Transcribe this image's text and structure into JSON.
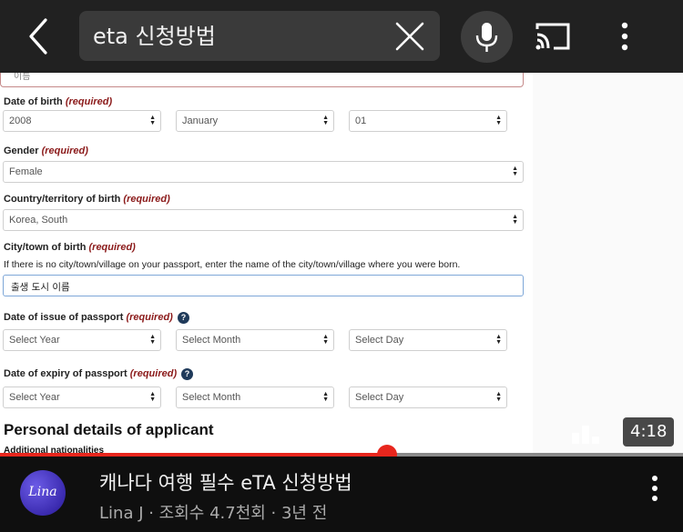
{
  "search": {
    "query": "eta 신청방법"
  },
  "video": {
    "duration": "4:18",
    "progress_fraction": 0.567,
    "form": {
      "field_remnant": "이름",
      "dob_label": "Date of birth",
      "required_text": "(required)",
      "dob_year": "2008",
      "dob_month": "January",
      "dob_day": "01",
      "gender_label": "Gender",
      "gender_value": "Female",
      "country_label": "Country/territory of birth",
      "country_value": "Korea, South",
      "city_label": "City/town of birth",
      "city_hint": "If there is no city/town/village on your passport, enter the name of the city/town/village where you were born.",
      "city_value": "출생 도시 이름",
      "issue_label": "Date of issue of passport",
      "expiry_label": "Date of expiry of passport",
      "select_year": "Select Year",
      "select_month": "Select Month",
      "select_day": "Select Day",
      "help_glyph": "?",
      "section_title": "Personal details of applicant",
      "section_sub": "Additional nationalities"
    }
  },
  "details": {
    "title": "캐나다 여행 필수 eTA 신청방법",
    "meta": "Lina J · 조회수 4.7천회 · 3년 전",
    "avatar_text": "Lina"
  },
  "colors": {
    "progress": "#e8261d",
    "required": "#8b1a1a",
    "background": "#0f0f0f"
  },
  "icons": [
    "back-arrow-icon",
    "close-icon",
    "mic-icon",
    "cast-icon",
    "more-vert-icon",
    "bar-chart-icon",
    "help-icon"
  ]
}
